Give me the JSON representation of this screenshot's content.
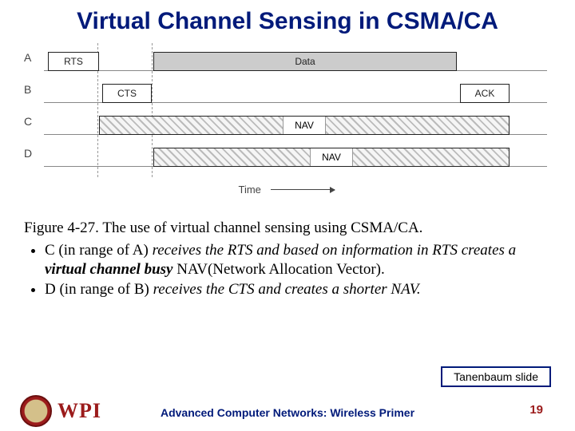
{
  "title": "Virtual Channel Sensing in CSMA/CA",
  "diagram": {
    "rows": {
      "a": "A",
      "b": "B",
      "c": "C",
      "d": "D"
    },
    "boxes": {
      "rts": "RTS",
      "cts": "CTS",
      "data": "Data",
      "ack": "ACK",
      "nav_c": "NAV",
      "nav_d": "NAV"
    },
    "time_label": "Time"
  },
  "caption": {
    "figure_line": "Figure 4-27. The use of virtual channel sensing using CSMA/CA.",
    "bullet1_pre": "C (in range of A) ",
    "bullet1_italic1": "receives the RTS and  based on information in RTS creates a ",
    "bullet1_bold": "virtual channel busy ",
    "bullet1_post": "NAV(Network Allocation Vector).",
    "bullet2_pre": "D (in range of B) ",
    "bullet2_italic": "receives the CTS and creates a shorter NAV."
  },
  "credit": "Tanenbaum slide",
  "footer": {
    "logo_text": "WPI",
    "center": "Advanced Computer Networks:  Wireless Primer",
    "page": "19"
  }
}
